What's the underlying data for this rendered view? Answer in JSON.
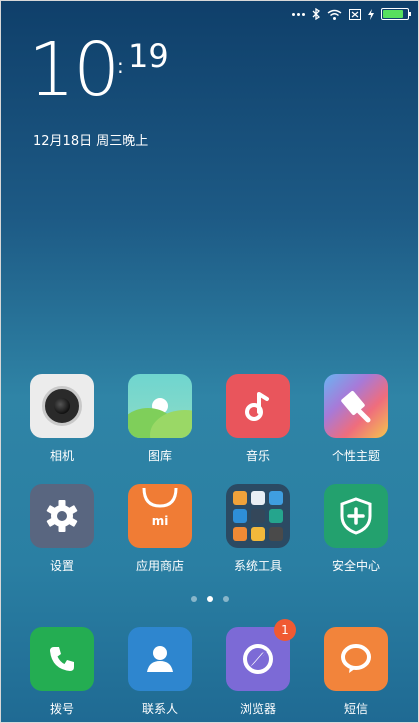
{
  "status_bar": {
    "icons": [
      "more-dots-icon",
      "bluetooth-icon",
      "wifi-icon",
      "no-sim-icon",
      "charging-icon",
      "battery-icon"
    ],
    "battery_level": 0.9,
    "battery_color": "#57e05e"
  },
  "lockscreen": {
    "hour": "10",
    "minute": "19",
    "colon": ":",
    "date": "12月18日 周三晚上"
  },
  "home": {
    "row1": [
      {
        "label": "相机",
        "icon": "camera-icon"
      },
      {
        "label": "图库",
        "icon": "gallery-icon"
      },
      {
        "label": "音乐",
        "icon": "music-note-icon"
      },
      {
        "label": "个性主题",
        "icon": "theme-brush-icon"
      }
    ],
    "row2": [
      {
        "label": "设置",
        "icon": "gear-icon"
      },
      {
        "label": "应用商店",
        "icon": "shopping-bag-icon",
        "logo_text": "mi"
      },
      {
        "label": "系统工具",
        "icon": "folder-icon"
      },
      {
        "label": "安全中心",
        "icon": "shield-icon"
      }
    ],
    "pages": {
      "count": 3,
      "current": 2
    }
  },
  "dock": [
    {
      "label": "拨号",
      "icon": "phone-icon"
    },
    {
      "label": "联系人",
      "icon": "contact-icon"
    },
    {
      "label": "浏览器",
      "icon": "browser-icon",
      "badge": "1"
    },
    {
      "label": "短信",
      "icon": "message-icon"
    }
  ]
}
